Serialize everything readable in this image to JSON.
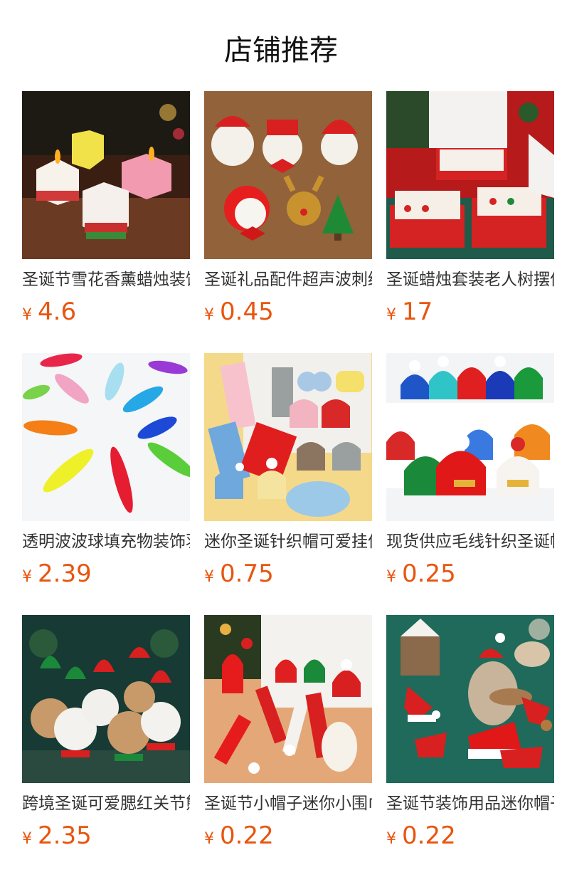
{
  "section": {
    "title": "店铺推荐"
  },
  "products": [
    {
      "name": "圣诞节雪花香薰蜡烛装饰",
      "currency": "¥",
      "price": "4.6"
    },
    {
      "name": "圣诞礼品配件超声波刺绣",
      "currency": "¥",
      "price": "0.45"
    },
    {
      "name": "圣诞蜡烛套装老人树摆件",
      "currency": "¥",
      "price": "17"
    },
    {
      "name": "透明波波球填充物装饰羽毛",
      "currency": "¥",
      "price": "2.39"
    },
    {
      "name": "迷你圣诞针织帽可爱挂件",
      "currency": "¥",
      "price": "0.75"
    },
    {
      "name": "现货供应毛线针织圣诞帽",
      "currency": "¥",
      "price": "0.25"
    },
    {
      "name": "跨境圣诞可爱腮红关节熊",
      "currency": "¥",
      "price": "2.35"
    },
    {
      "name": "圣诞节小帽子迷你小围巾",
      "currency": "¥",
      "price": "0.22"
    },
    {
      "name": "圣诞节装饰用品迷你帽子",
      "currency": "¥",
      "price": "0.22"
    }
  ],
  "images": [
    {
      "icon": "snowflake-candles-photo"
    },
    {
      "icon": "felt-christmas-patches-photo"
    },
    {
      "icon": "christmas-candle-boxes-photo"
    },
    {
      "icon": "colorful-feathers-photo"
    },
    {
      "icon": "mini-knit-hats-scarves-photo"
    },
    {
      "icon": "knit-pompom-hats-photo"
    },
    {
      "icon": "christmas-teddy-bears-photo"
    },
    {
      "icon": "mini-hats-red-scarves-photo"
    },
    {
      "icon": "mini-santa-hats-photo"
    }
  ]
}
